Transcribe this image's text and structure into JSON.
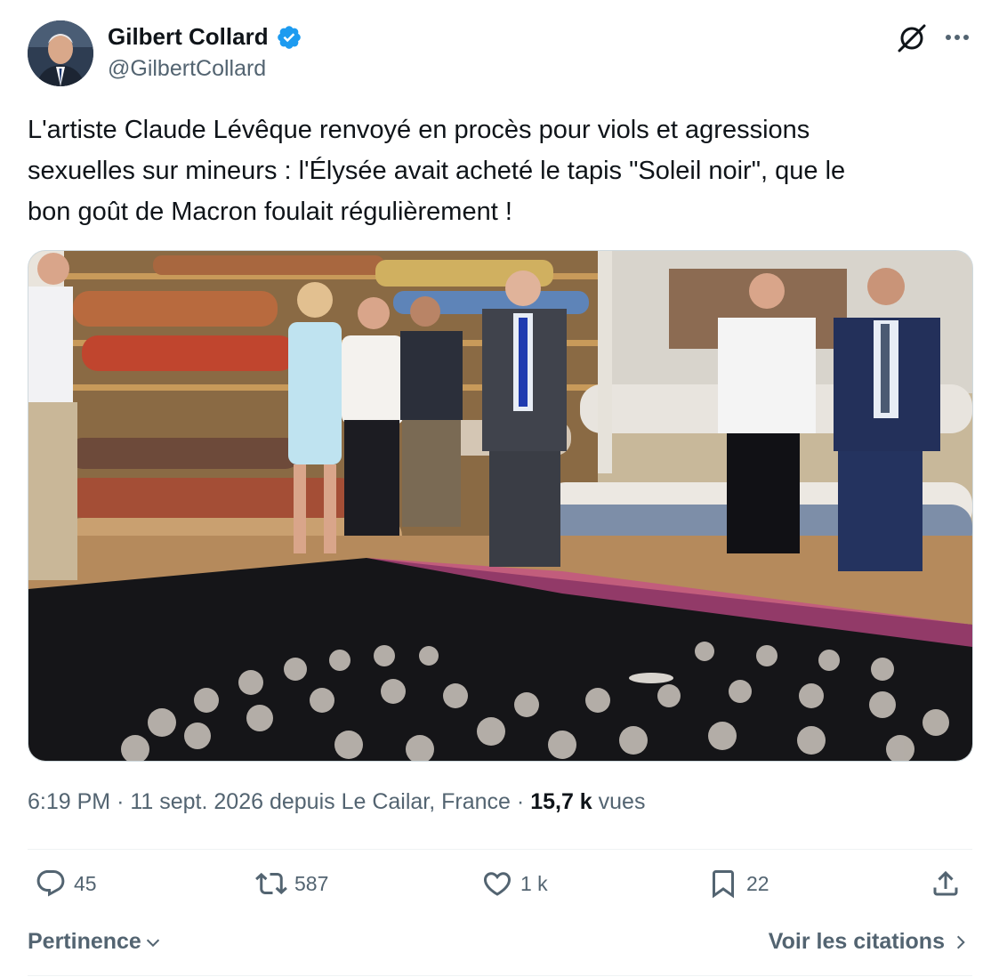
{
  "author": {
    "display_name": "Gilbert Collard",
    "handle": "@GilbertCollard",
    "verified": true,
    "verified_color": "#1d9bf0"
  },
  "tweet": {
    "text": "L'artiste Claude Lévêque renvoyé en procès pour viols et agressions\nsexuelles sur mineurs : l'Élysée avait acheté le tapis \"Soleil noir\", que le\nbon goût de Macron foulait régulièrement !",
    "time": "6:19 PM",
    "date": "11 sept. 2026",
    "location": "depuis Le Cailar, France",
    "views_count": "15,7 k",
    "views_label": "vues"
  },
  "media": {
    "kind": "photo",
    "description_icon": "photo"
  },
  "actions": {
    "reply_count": "45",
    "retweet_count": "587",
    "like_count": "1 k",
    "bookmark_count": "22"
  },
  "footer": {
    "sort_label": "Pertinence",
    "quotes_link": "Voir les citations"
  },
  "colors": {
    "text_primary": "#0f1419",
    "text_secondary": "#536471",
    "border": "#eff3f4",
    "accent": "#1d9bf0"
  }
}
